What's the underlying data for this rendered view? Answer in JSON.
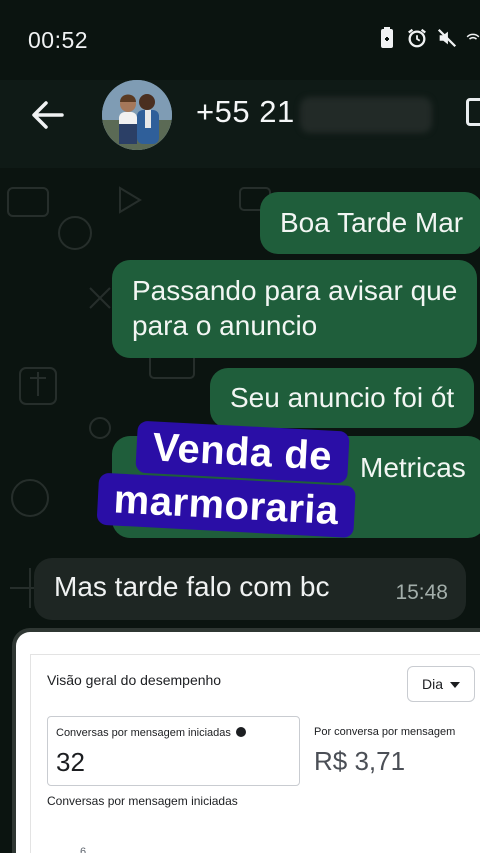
{
  "status_bar": {
    "time": "00:52",
    "icons": [
      "battery-saver-icon",
      "alarm-icon",
      "mute-icon",
      "wifi-icon"
    ]
  },
  "header": {
    "contact": "+55 21",
    "back_icon": "arrow-left-icon",
    "avatar": "contact-avatar"
  },
  "messages": [
    {
      "dir": "out",
      "text": "Boa Tarde Mar"
    },
    {
      "dir": "out",
      "text_line1": "Passando para avisar que",
      "text_line2": "para o anuncio"
    },
    {
      "dir": "out",
      "text": "Seu anuncio foi ót"
    },
    {
      "dir": "out",
      "text": "Metricas"
    },
    {
      "dir": "in",
      "text": "Mas tarde falo com bc",
      "time": "15:48"
    }
  ],
  "sticker": {
    "line1": "Venda de",
    "line2": "marmoraria"
  },
  "screenshot_card": {
    "title": "Visão geral do desempenho",
    "period": "Dia",
    "metric1_label": "Conversas por mensagem iniciadas",
    "metric1_value": "32",
    "metric2_label": "Por conversa por mensagem",
    "metric2_value": "R$ 3,71",
    "chart_title": "Conversas por mensagem iniciadas",
    "axis_tick": "6"
  },
  "colors": {
    "outgoing_bubble": "#1f5e3b",
    "incoming_bubble": "#1e2623",
    "background": "#0b1410",
    "sticker": "#2a0ea6"
  }
}
